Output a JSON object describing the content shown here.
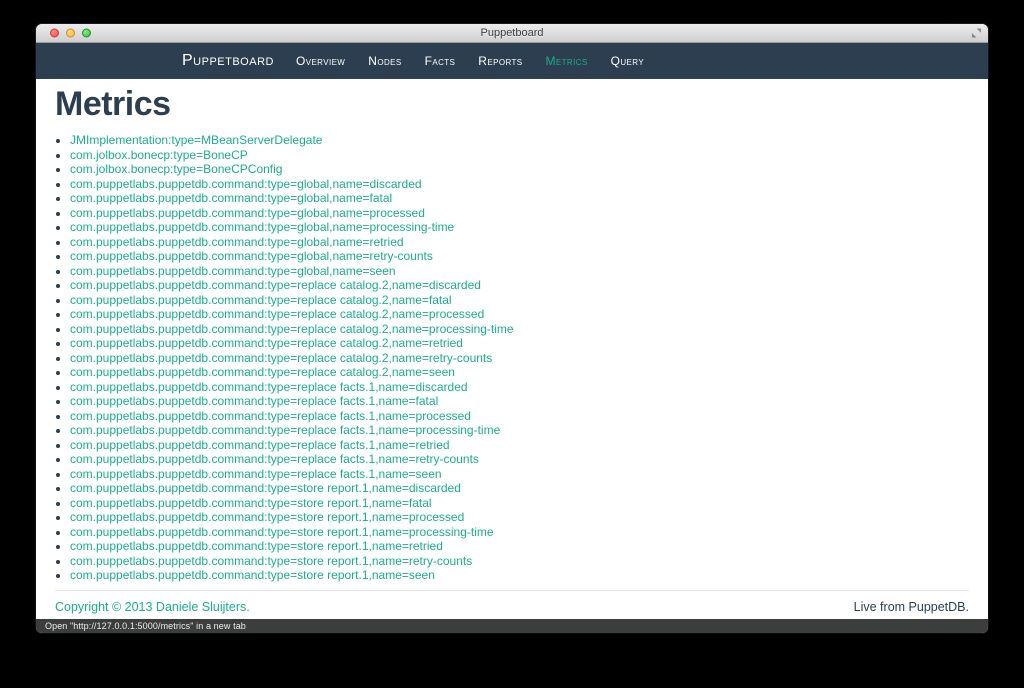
{
  "colors": {
    "accent": "#1bae8c",
    "navbar_bg": "#2c3e50",
    "heading": "#2c3e50",
    "text": "#2c3e50"
  },
  "window": {
    "title": "Puppetboard",
    "status_text": "Open \"http://127.0.0.1:5000/metrics\" in a new tab"
  },
  "navbar": {
    "brand": "Puppetboard",
    "items": [
      {
        "label": "Overview",
        "active": false
      },
      {
        "label": "Nodes",
        "active": false
      },
      {
        "label": "Facts",
        "active": false
      },
      {
        "label": "Reports",
        "active": false
      },
      {
        "label": "Metrics",
        "active": true
      },
      {
        "label": "Query",
        "active": false
      }
    ]
  },
  "main": {
    "title": "Metrics",
    "metrics": [
      "JMImplementation:type=MBeanServerDelegate",
      "com.jolbox.bonecp:type=BoneCP",
      "com.jolbox.bonecp:type=BoneCPConfig",
      "com.puppetlabs.puppetdb.command:type=global,name=discarded",
      "com.puppetlabs.puppetdb.command:type=global,name=fatal",
      "com.puppetlabs.puppetdb.command:type=global,name=processed",
      "com.puppetlabs.puppetdb.command:type=global,name=processing-time",
      "com.puppetlabs.puppetdb.command:type=global,name=retried",
      "com.puppetlabs.puppetdb.command:type=global,name=retry-counts",
      "com.puppetlabs.puppetdb.command:type=global,name=seen",
      "com.puppetlabs.puppetdb.command:type=replace catalog.2,name=discarded",
      "com.puppetlabs.puppetdb.command:type=replace catalog.2,name=fatal",
      "com.puppetlabs.puppetdb.command:type=replace catalog.2,name=processed",
      "com.puppetlabs.puppetdb.command:type=replace catalog.2,name=processing-time",
      "com.puppetlabs.puppetdb.command:type=replace catalog.2,name=retried",
      "com.puppetlabs.puppetdb.command:type=replace catalog.2,name=retry-counts",
      "com.puppetlabs.puppetdb.command:type=replace catalog.2,name=seen",
      "com.puppetlabs.puppetdb.command:type=replace facts.1,name=discarded",
      "com.puppetlabs.puppetdb.command:type=replace facts.1,name=fatal",
      "com.puppetlabs.puppetdb.command:type=replace facts.1,name=processed",
      "com.puppetlabs.puppetdb.command:type=replace facts.1,name=processing-time",
      "com.puppetlabs.puppetdb.command:type=replace facts.1,name=retried",
      "com.puppetlabs.puppetdb.command:type=replace facts.1,name=retry-counts",
      "com.puppetlabs.puppetdb.command:type=replace facts.1,name=seen",
      "com.puppetlabs.puppetdb.command:type=store report.1,name=discarded",
      "com.puppetlabs.puppetdb.command:type=store report.1,name=fatal",
      "com.puppetlabs.puppetdb.command:type=store report.1,name=processed",
      "com.puppetlabs.puppetdb.command:type=store report.1,name=processing-time",
      "com.puppetlabs.puppetdb.command:type=store report.1,name=retried",
      "com.puppetlabs.puppetdb.command:type=store report.1,name=retry-counts",
      "com.puppetlabs.puppetdb.command:type=store report.1,name=seen"
    ]
  },
  "footer": {
    "left": "Copyright © 2013 Daniele Sluijters.",
    "right": "Live from PuppetDB."
  }
}
